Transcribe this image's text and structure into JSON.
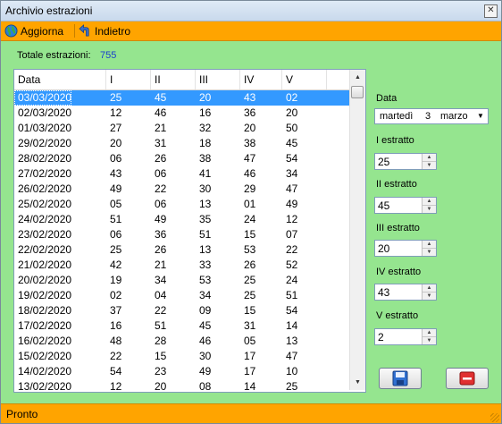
{
  "window": {
    "title": "Archivio estrazioni",
    "close_glyph": "✕"
  },
  "toolbar": {
    "refresh_label": "Aggiorna",
    "back_label": "Indietro"
  },
  "summary": {
    "label": "Totale estrazioni:",
    "value": "755"
  },
  "table": {
    "columns": [
      "Data",
      "I",
      "II",
      "III",
      "IV",
      "V"
    ],
    "rows": [
      [
        "03/03/2020",
        "25",
        "45",
        "20",
        "43",
        "02"
      ],
      [
        "02/03/2020",
        "12",
        "46",
        "16",
        "36",
        "20"
      ],
      [
        "01/03/2020",
        "27",
        "21",
        "32",
        "20",
        "50"
      ],
      [
        "29/02/2020",
        "20",
        "31",
        "18",
        "38",
        "45"
      ],
      [
        "28/02/2020",
        "06",
        "26",
        "38",
        "47",
        "54"
      ],
      [
        "27/02/2020",
        "43",
        "06",
        "41",
        "46",
        "34"
      ],
      [
        "26/02/2020",
        "49",
        "22",
        "30",
        "29",
        "47"
      ],
      [
        "25/02/2020",
        "05",
        "06",
        "13",
        "01",
        "49"
      ],
      [
        "24/02/2020",
        "51",
        "49",
        "35",
        "24",
        "12"
      ],
      [
        "23/02/2020",
        "06",
        "36",
        "51",
        "15",
        "07"
      ],
      [
        "22/02/2020",
        "25",
        "26",
        "13",
        "53",
        "22"
      ],
      [
        "21/02/2020",
        "42",
        "21",
        "33",
        "26",
        "52"
      ],
      [
        "20/02/2020",
        "19",
        "34",
        "53",
        "25",
        "24"
      ],
      [
        "19/02/2020",
        "02",
        "04",
        "34",
        "25",
        "51"
      ],
      [
        "18/02/2020",
        "37",
        "22",
        "09",
        "15",
        "54"
      ],
      [
        "17/02/2020",
        "16",
        "51",
        "45",
        "31",
        "14"
      ],
      [
        "16/02/2020",
        "48",
        "28",
        "46",
        "05",
        "13"
      ],
      [
        "15/02/2020",
        "22",
        "15",
        "30",
        "17",
        "47"
      ],
      [
        "14/02/2020",
        "54",
        "23",
        "49",
        "17",
        "10"
      ],
      [
        "13/02/2020",
        "12",
        "20",
        "08",
        "14",
        "25"
      ]
    ],
    "selected_row": 0
  },
  "form": {
    "date_label": "Data",
    "date_weekday": "martedì",
    "date_day": "3",
    "date_month": "marzo",
    "fields": [
      {
        "label": "I estratto",
        "value": "25"
      },
      {
        "label": "II estratto",
        "value": "45"
      },
      {
        "label": "III estratto",
        "value": "20"
      },
      {
        "label": "IV estratto",
        "value": "43"
      },
      {
        "label": "V estratto",
        "value": "2"
      }
    ]
  },
  "status": {
    "text": "Pronto"
  },
  "colors": {
    "background": "#95e58f",
    "toolbar": "#ffa400",
    "selection": "#3399ff",
    "total_value": "#1a3fcc"
  }
}
